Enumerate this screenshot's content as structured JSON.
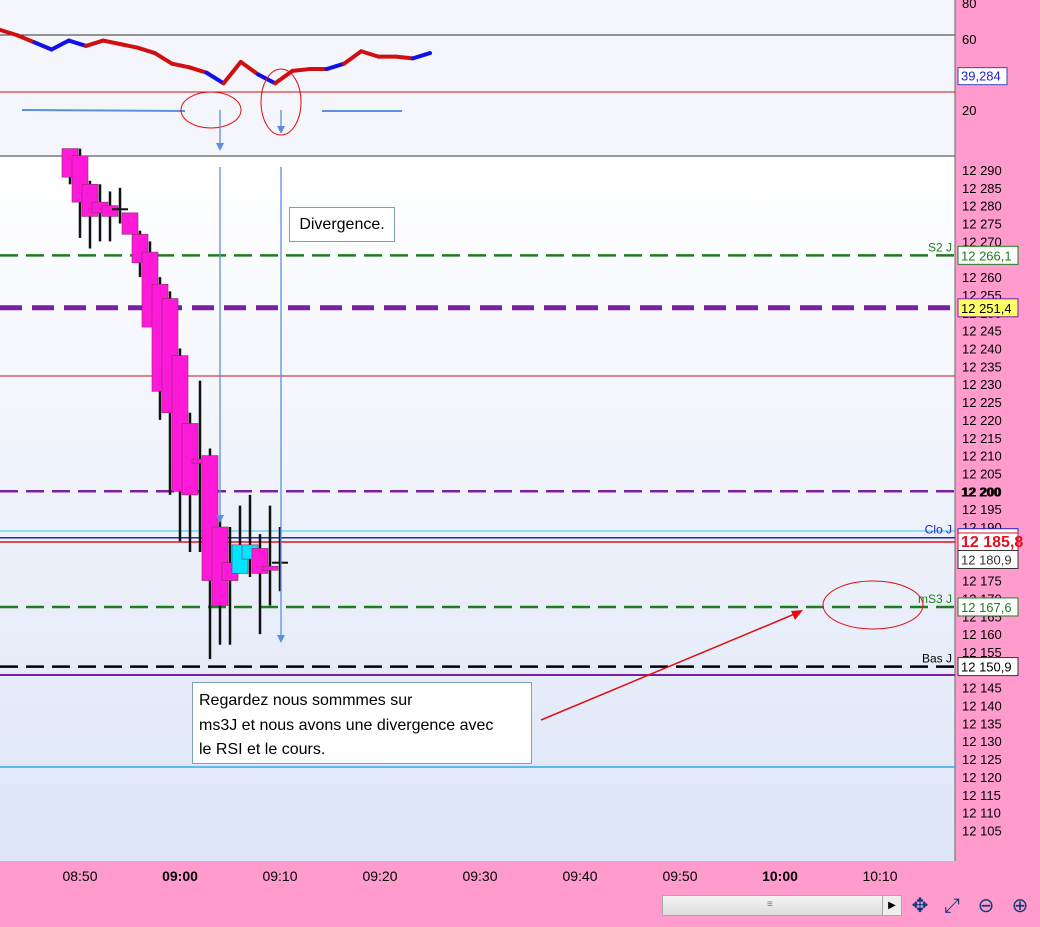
{
  "chart_data": {
    "type": "candlestick",
    "x_ticks": [
      "08:50",
      "09:00",
      "09:10",
      "09:20",
      "09:30",
      "09:40",
      "09:50",
      "10:00",
      "10:10"
    ],
    "bold_x_ticks": [
      "09:00",
      "10:00"
    ],
    "rsi_panel": {
      "ticks": [
        "80",
        "60",
        "20"
      ],
      "current_value": "39,284",
      "line_values": [
        65,
        62,
        58,
        54,
        59,
        56,
        59,
        57,
        55,
        52,
        46,
        44,
        41,
        35,
        47,
        40,
        35,
        42,
        43,
        43,
        46,
        53,
        50,
        50,
        49,
        52
      ],
      "colors": [
        "red",
        "red",
        "red",
        "blue",
        "blue",
        "blue",
        "red",
        "red",
        "red",
        "red",
        "red",
        "red",
        "red",
        "blue",
        "red",
        "red",
        "blue",
        "red",
        "red",
        "red",
        "blue",
        "red",
        "red",
        "red",
        "red",
        "blue"
      ]
    },
    "price_ticks": [
      "12 290",
      "12 285",
      "12 280",
      "12 275",
      "12 270",
      "12 265",
      "12 260",
      "12 255",
      "12 250",
      "12 245",
      "12 240",
      "12 235",
      "12 230",
      "12 225",
      "12 220",
      "12 215",
      "12 210",
      "12 205",
      "12 200",
      "12 195",
      "12 190",
      "12 185",
      "12 180",
      "12 175",
      "12 170",
      "12 165",
      "12 160",
      "12 155",
      "12 150",
      "12 145",
      "12 140",
      "12 135",
      "12 130",
      "12 125",
      "12 120",
      "12 115",
      "12 110",
      "12 105"
    ],
    "candles": [
      {
        "time": "08:49",
        "open": 12296,
        "high": 12296,
        "low": 12286,
        "close": 12288,
        "color": "magenta"
      },
      {
        "time": "08:50",
        "open": 12294,
        "high": 12296,
        "low": 12271,
        "close": 12281,
        "color": "magenta"
      },
      {
        "time": "08:51",
        "open": 12286,
        "high": 12287,
        "low": 12268,
        "close": 12277,
        "color": "magenta"
      },
      {
        "time": "08:52",
        "open": 12281,
        "high": 12286,
        "low": 12270,
        "close": 12278,
        "color": "magenta"
      },
      {
        "time": "08:53",
        "open": 12280,
        "high": 12284,
        "low": 12270,
        "close": 12277,
        "color": "magenta"
      },
      {
        "time": "08:54",
        "open": 12279,
        "high": 12285,
        "low": 12275,
        "close": 12279,
        "color": "doji"
      },
      {
        "time": "08:55",
        "open": 12278,
        "high": 12278,
        "low": 12273,
        "close": 12272,
        "color": "magenta"
      },
      {
        "time": "08:56",
        "open": 12272,
        "high": 12273,
        "low": 12260,
        "close": 12264,
        "color": "magenta"
      },
      {
        "time": "08:57",
        "open": 12267,
        "high": 12270,
        "low": 12258,
        "close": 12246,
        "color": "magenta"
      },
      {
        "time": "08:58",
        "open": 12258,
        "high": 12260,
        "low": 12220,
        "close": 12228,
        "color": "magenta"
      },
      {
        "time": "08:59",
        "open": 12254,
        "high": 12256,
        "low": 12199,
        "close": 12222,
        "color": "magenta"
      },
      {
        "time": "09:00",
        "open": 12238,
        "high": 12240,
        "low": 12186,
        "close": 12200,
        "color": "magenta"
      },
      {
        "time": "09:01",
        "open": 12219,
        "high": 12222,
        "low": 12183,
        "close": 12199,
        "color": "magenta"
      },
      {
        "time": "09:02",
        "open": 12209,
        "high": 12231,
        "low": 12183,
        "close": 12208,
        "color": "magenta"
      },
      {
        "time": "09:03",
        "open": 12210,
        "high": 12212,
        "low": 12153,
        "close": 12175,
        "color": "magenta"
      },
      {
        "time": "09:04",
        "open": 12190,
        "high": 12192,
        "low": 12157,
        "close": 12168,
        "color": "magenta"
      },
      {
        "time": "09:05",
        "open": 12175,
        "high": 12190,
        "low": 12157,
        "close": 12180,
        "color": "magenta"
      },
      {
        "time": "09:06",
        "open": 12185,
        "high": 12196,
        "low": 12177,
        "close": 12177,
        "color": "cyan"
      },
      {
        "time": "09:07",
        "open": 12185,
        "high": 12199,
        "low": 12176,
        "close": 12181,
        "color": "cyan"
      },
      {
        "time": "09:08",
        "open": 12184,
        "high": 12188,
        "low": 12160,
        "close": 12177,
        "color": "magenta"
      },
      {
        "time": "09:09",
        "open": 12179,
        "high": 12196,
        "low": 12168,
        "close": 12179,
        "color": "magenta"
      },
      {
        "time": "09:10",
        "open": 12180,
        "high": 12190,
        "low": 12172,
        "close": 12180,
        "color": "doji"
      }
    ],
    "levels": [
      {
        "label": "S2 J",
        "value": "12 266,1",
        "color": "#1e7d1e",
        "style": "dashed"
      },
      {
        "label": "",
        "value": "12 251,4",
        "color": "#7a1fa2",
        "style": "dashed-thick"
      },
      {
        "label": "",
        "value": "12 200",
        "color": "#7a1fa2",
        "style": "dashed"
      },
      {
        "label": "Clo J",
        "value": "12 187,0",
        "color": "#2222cc",
        "style": "solid"
      },
      {
        "label": "",
        "value": "12 185,8",
        "color": "#e01020",
        "style": "solid"
      },
      {
        "label": "",
        "value": "12 180,9",
        "color": "#333333",
        "style": "none"
      },
      {
        "label": "mS3 J",
        "value": "12 167,6",
        "color": "#1e7d1e",
        "style": "dashed"
      },
      {
        "label": "Bas J",
        "value": "12 150,9",
        "color": "#000000",
        "style": "dashed"
      }
    ],
    "annotations": {
      "divergence_label": "Divergence.",
      "comment_lines": [
        "Regardez nous sommmes sur",
        "ms3J et nous avons une divergence avec",
        "le RSI et le cours."
      ]
    },
    "colors": {
      "bull": "#00e5ff",
      "bear": "#ff1ad9",
      "axis_bg": "#ff9ccd",
      "panel_bg_top": "#ffffff",
      "panel_bg_bottom": "#dde5f7"
    }
  },
  "toolbar": {
    "icons": [
      "crosshair-icon",
      "zoom-fit-icon",
      "zoom-out-icon",
      "zoom-in-icon"
    ]
  }
}
